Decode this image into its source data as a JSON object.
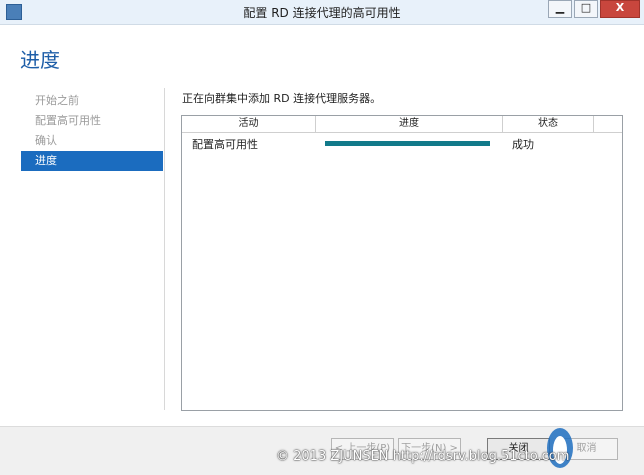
{
  "window": {
    "title": "配置 RD 连接代理的高可用性",
    "controls": {
      "minimize": "▁",
      "maximize": "□",
      "close": "X"
    }
  },
  "page": {
    "heading": "进度",
    "description": "正在向群集中添加 RD 连接代理服务器。"
  },
  "nav": {
    "items": [
      {
        "label": "开始之前",
        "state": "disabled"
      },
      {
        "label": "配置高可用性",
        "state": "disabled"
      },
      {
        "label": "确认",
        "state": "disabled"
      },
      {
        "label": "进度",
        "state": "active"
      }
    ]
  },
  "grid": {
    "columns": [
      "活动",
      "进度",
      "状态"
    ],
    "rows": [
      {
        "activity": "配置高可用性",
        "progress": 1.0,
        "status": "成功"
      }
    ]
  },
  "footer": {
    "prev_label": "< 上一步(P)",
    "next_label": "下一步(N) >",
    "close_label": "关闭",
    "cancel_label": "取消"
  },
  "watermark": {
    "text": "© 2013 ZJUNSEN http://rdsrv.blog.51cto.com",
    "logo_text": "运维网",
    "logo_sub": "iyunv.com"
  },
  "colors": {
    "accent": "#1b6cbf",
    "heading": "#1e5ea8",
    "progress": "#127a8a",
    "close_button": "#c8463d"
  }
}
